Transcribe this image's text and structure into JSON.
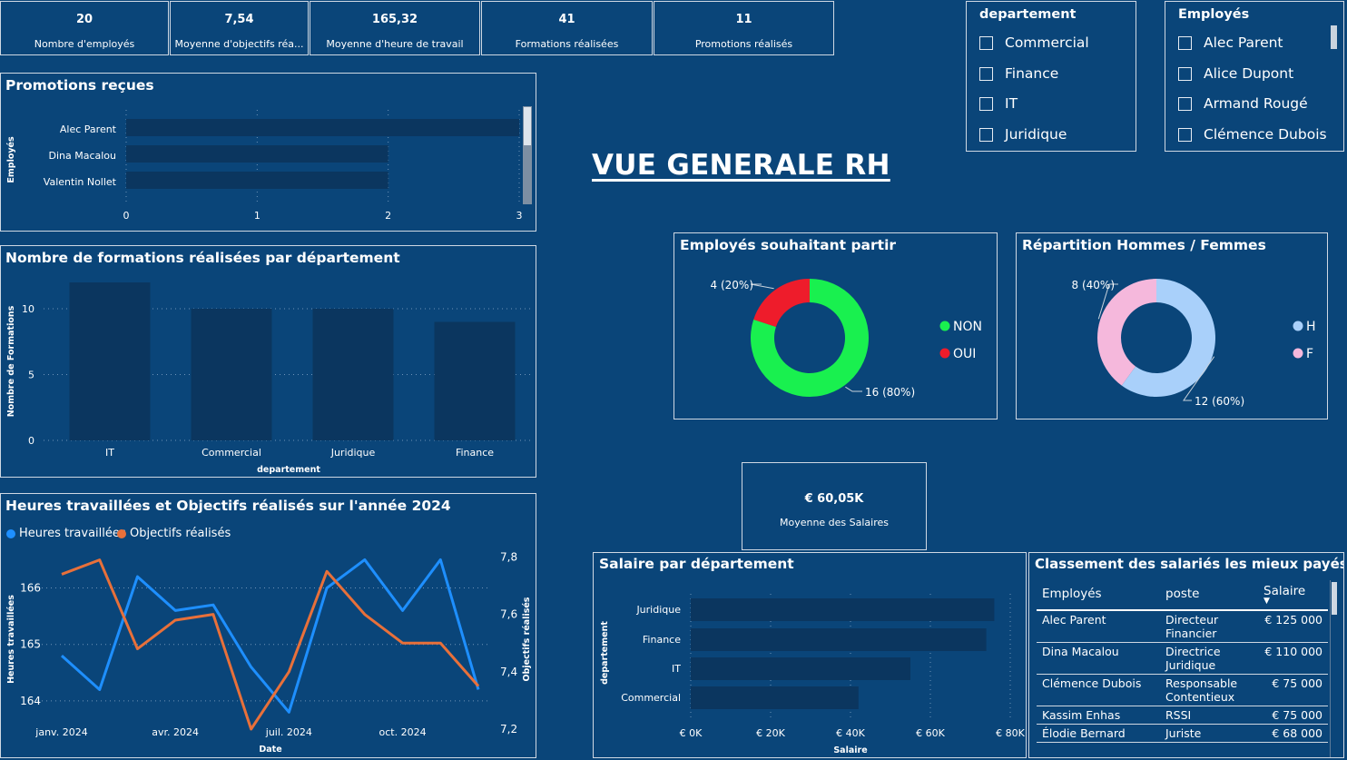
{
  "kpis": [
    {
      "value": "20",
      "label": "Nombre d'employés"
    },
    {
      "value": "7,54",
      "label": "Moyenne d'objectifs réa..."
    },
    {
      "value": "165,32",
      "label": "Moyenne d'heure de travail"
    },
    {
      "value": "41",
      "label": "Formations réalisées"
    },
    {
      "value": "11",
      "label": "Promotions réalisés"
    }
  ],
  "slicers": {
    "departement": {
      "title": "departement",
      "items": [
        "Commercial",
        "Finance",
        "IT",
        "Juridique"
      ]
    },
    "employes": {
      "title": "Employés",
      "items": [
        "Alec Parent",
        "Alice Dupont",
        "Armand Rougé",
        "Clémence Dubois"
      ]
    }
  },
  "main_title": "VUE GENERALE RH",
  "salary_kpi": {
    "value": "€ 60,05K",
    "label": "Moyenne des Salaires"
  },
  "colors": {
    "background": "#0a4579",
    "bar": "#0b365f",
    "line_blue": "#1e8fff",
    "line_orange": "#e8703a",
    "green": "#19f04f",
    "red": "#ee1c2b",
    "light_blue": "#a9d0fa",
    "pink": "#f5b8dc"
  },
  "ranking": {
    "title": "Classement des salariés les mieux payés",
    "headers": [
      "Employés",
      "poste",
      "Salaire"
    ],
    "rows": [
      [
        "Alec Parent",
        "Directeur Financier",
        "€ 125 000"
      ],
      [
        "Dina Macalou",
        "Directrice Juridique",
        "€ 110 000"
      ],
      [
        "Clémence Dubois",
        "Responsable Contentieux",
        "€ 75 000"
      ],
      [
        "Kassim Enhas",
        "RSSI",
        "€ 75 000"
      ],
      [
        "Élodie Bernard",
        "Juriste",
        "€ 68 000"
      ]
    ]
  },
  "chart_data": [
    {
      "type": "bar",
      "orientation": "horizontal",
      "title": "Promotions reçues",
      "ylabel": "Employés",
      "categories": [
        "Alec Parent",
        "Dina Macalou",
        "Valentin Nollet"
      ],
      "values": [
        3,
        2,
        2
      ],
      "xlim": [
        0,
        3
      ],
      "xticks": [
        "0",
        "1",
        "2",
        "3"
      ]
    },
    {
      "type": "bar",
      "title": "Nombre de formations réalisées par département",
      "xlabel": "departement",
      "ylabel": "Nombre de Formations",
      "categories": [
        "IT",
        "Commercial",
        "Juridique",
        "Finance"
      ],
      "values": [
        12,
        10,
        10,
        9
      ],
      "ylim": [
        0,
        12
      ],
      "yticks": [
        "0",
        "5",
        "10"
      ]
    },
    {
      "type": "line",
      "title": "Heures travaillées et Objectifs réalisés sur l'année 2024",
      "xlabel": "Date",
      "ylabel": "Heures travaillées",
      "ylabel_right": "Objectifs réalisés",
      "x": [
        "2024-01",
        "2024-02",
        "2024-03",
        "2024-04",
        "2024-05",
        "2024-06",
        "2024-07",
        "2024-08",
        "2024-09",
        "2024-10",
        "2024-11",
        "2024-12"
      ],
      "xticks": [
        "janv. 2024",
        "avr. 2024",
        "juil. 2024",
        "oct. 2024"
      ],
      "ylim_left": [
        163.5,
        166.7
      ],
      "ylim_right": [
        7.2,
        7.83
      ],
      "yticks_left": [
        "164",
        "165",
        "166"
      ],
      "yticks_right": [
        "7,2",
        "7,4",
        "7,6",
        "7,8"
      ],
      "series": [
        {
          "name": "Heures travaillées",
          "axis": "left",
          "values": [
            164.8,
            164.2,
            166.2,
            165.6,
            165.7,
            164.6,
            163.8,
            166.0,
            166.5,
            165.6,
            166.5,
            164.2
          ]
        },
        {
          "name": "Objectifs réalisés",
          "axis": "right",
          "values": [
            7.74,
            7.79,
            7.48,
            7.58,
            7.6,
            7.2,
            7.4,
            7.75,
            7.6,
            7.5,
            7.5,
            7.35
          ]
        }
      ]
    },
    {
      "type": "pie",
      "title": "Employés souhaitant partir",
      "series": [
        {
          "name": "NON",
          "value": 16,
          "label": "16 (80%)"
        },
        {
          "name": "OUI",
          "value": 4,
          "label": "4 (20%)"
        }
      ]
    },
    {
      "type": "pie",
      "title": "Répartition Hommes / Femmes",
      "series": [
        {
          "name": "H",
          "value": 12,
          "label": "12 (60%)"
        },
        {
          "name": "F",
          "value": 8,
          "label": "8 (40%)"
        }
      ]
    },
    {
      "type": "bar",
      "orientation": "horizontal",
      "title": "Salaire par département",
      "xlabel": "Salaire",
      "ylabel": "departement",
      "categories": [
        "Juridique",
        "Finance",
        "IT",
        "Commercial"
      ],
      "values": [
        76000,
        74000,
        55000,
        42000
      ],
      "xlim": [
        0,
        80000
      ],
      "xticks": [
        "€ 0K",
        "€ 20K",
        "€ 40K",
        "€ 60K",
        "€ 80K"
      ]
    }
  ]
}
